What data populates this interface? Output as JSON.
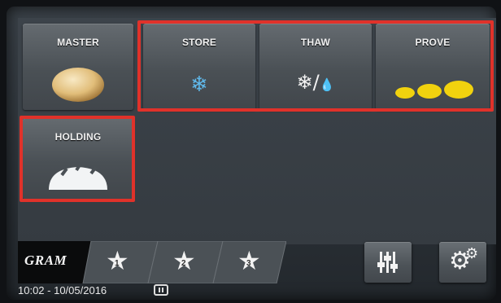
{
  "programs": [
    {
      "label": "MASTER"
    },
    {
      "label": "STORE"
    },
    {
      "label": "THAW"
    },
    {
      "label": "PROVE"
    },
    {
      "label": "HOLDING"
    }
  ],
  "favorites_tabs": [
    {
      "brand": "GRAM"
    },
    {
      "number": "1"
    },
    {
      "number": "2"
    },
    {
      "number": "3"
    }
  ],
  "toolbar": {
    "settings_icon": "sliders-icon",
    "service_icon": "gears-icon"
  },
  "status_bar": {
    "datetime": "10:02 - 10/05/2016"
  },
  "colors": {
    "highlight": "#e0322a",
    "snowflake": "#5fb8ea",
    "prove_bread": "#f1d20e"
  }
}
